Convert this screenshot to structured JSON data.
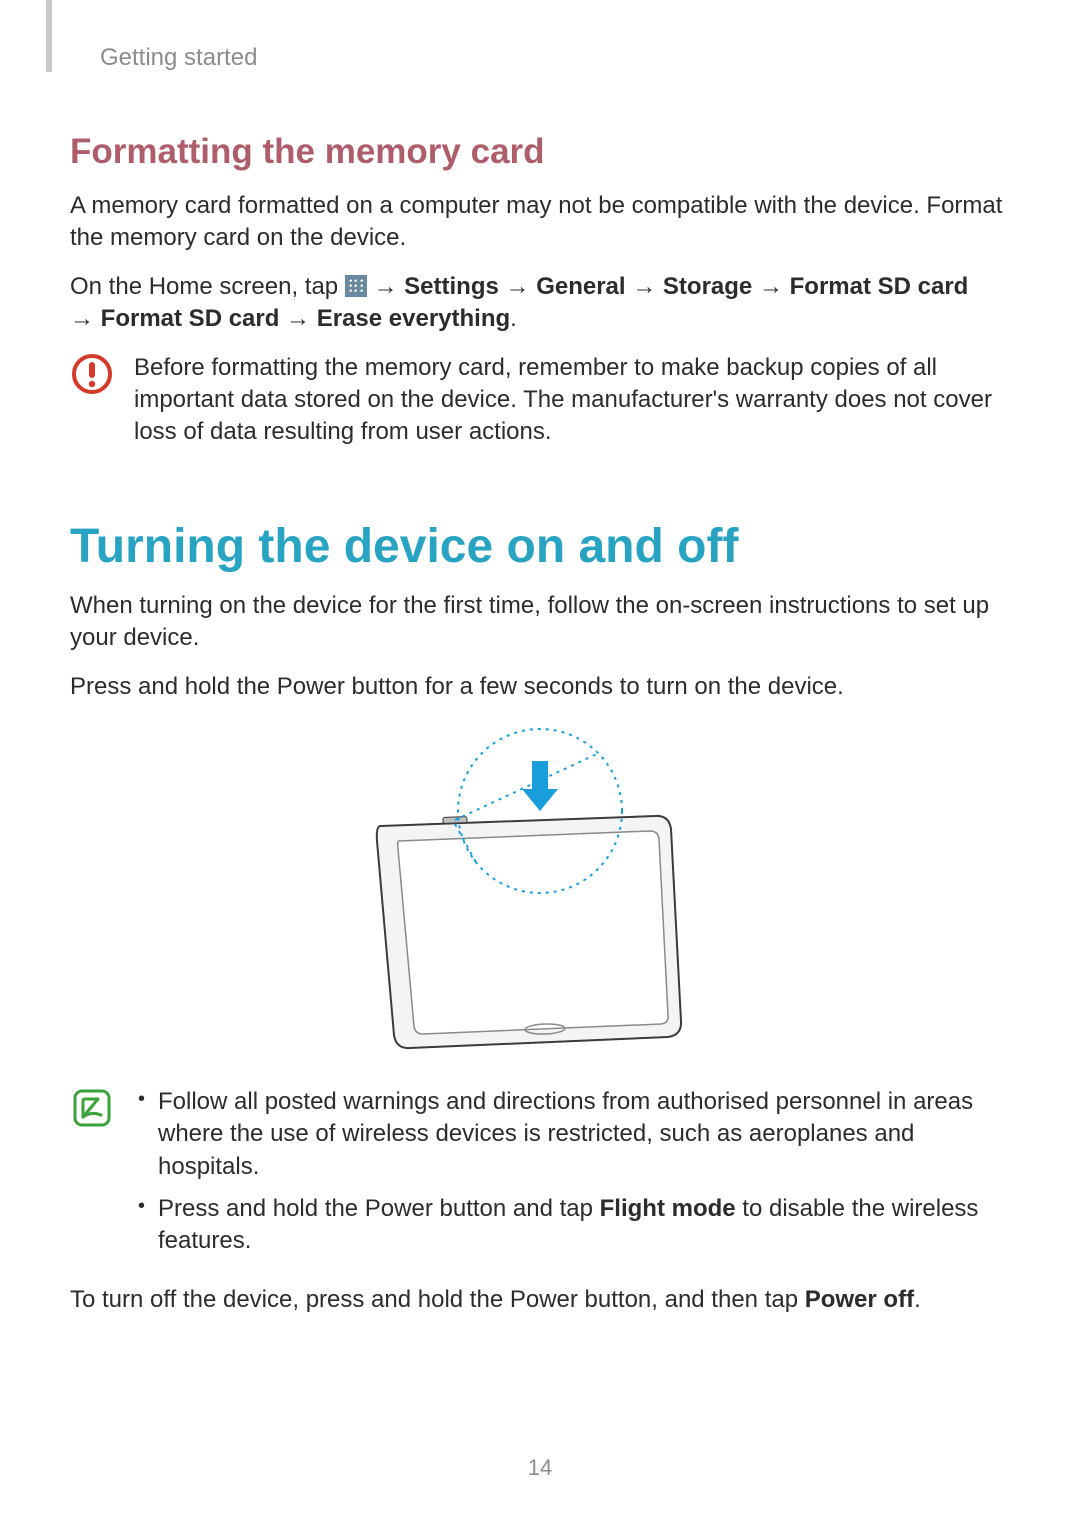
{
  "chapter": "Getting started",
  "section1": {
    "heading": "Formatting the memory card",
    "p1": "A memory card formatted on a computer may not be compatible with the device. Format the memory card on the device.",
    "tap_intro": "On the Home screen, tap ",
    "arrow": " → ",
    "path": {
      "a": "Settings",
      "b": "General",
      "c": "Storage",
      "d": "Format SD card",
      "e": "Format SD card",
      "f": "Erase everything"
    },
    "period": ".",
    "warning": "Before formatting the memory card, remember to make backup copies of all important data stored on the device. The manufacturer's warranty does not cover loss of data resulting from user actions."
  },
  "section2": {
    "heading": "Turning the device on and off",
    "p1": "When turning on the device for the first time, follow the on-screen instructions to set up your device.",
    "p2": "Press and hold the Power button for a few seconds to turn on the device.",
    "note_li1": "Follow all posted warnings and directions from authorised personnel in areas where the use of wireless devices is restricted, such as aeroplanes and hospitals.",
    "note_li2_a": "Press and hold the Power button and tap ",
    "note_li2_b": "Flight mode",
    "note_li2_c": " to disable the wireless features.",
    "p3_a": "To turn off the device, press and hold the Power button, and then tap ",
    "p3_b": "Power off",
    "p3_c": "."
  },
  "page_number": "14"
}
